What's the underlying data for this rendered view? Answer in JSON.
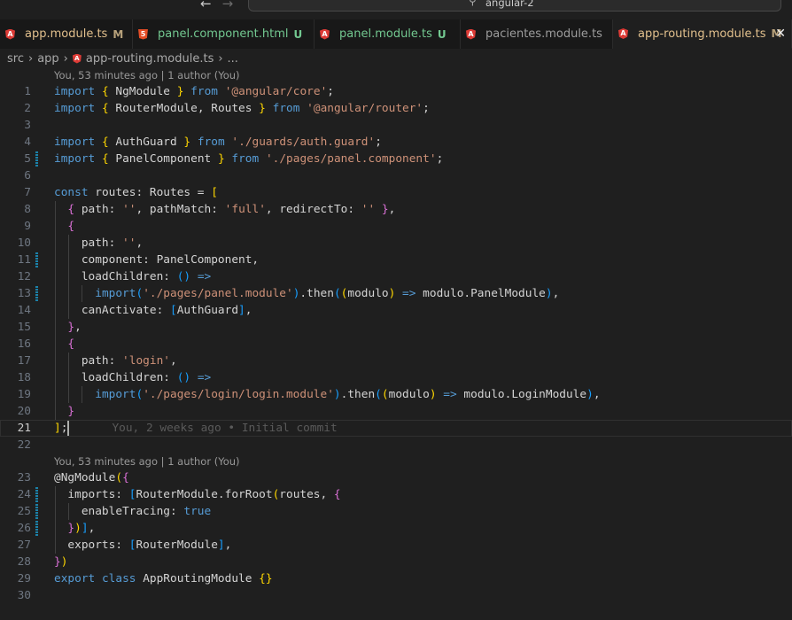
{
  "titlebar": {
    "search_text": "angular-2",
    "back": "←",
    "forward": "→"
  },
  "tabs": [
    {
      "label": "app.module.ts",
      "badge": "M",
      "icon": "angular-icon",
      "color": "#e2c08d",
      "badge_color": "#b8a27c"
    },
    {
      "label": "panel.component.html",
      "badge": "U",
      "icon": "html5-icon",
      "color": "#73c991",
      "badge_color": "#73c991"
    },
    {
      "label": "panel.module.ts",
      "badge": "U",
      "icon": "angular-icon",
      "color": "#73c991",
      "badge_color": "#73c991"
    },
    {
      "label": "pacientes.module.ts",
      "badge": "",
      "icon": "angular-icon",
      "color": "#9d9d9d",
      "badge_color": ""
    },
    {
      "label": "app-routing.module.ts",
      "badge": "M",
      "icon": "angular-icon",
      "color": "#e2c08d",
      "badge_color": "#b8a27c",
      "active": true
    }
  ],
  "breadcrumb": [
    "src",
    "app",
    "app-routing.module.ts",
    "..."
  ],
  "codelens": [
    "You, 53 minutes ago | 1 author (You)",
    "You, 53 minutes ago | 1 author (You)"
  ],
  "blame": "You, 2 weeks ago • Initial commit",
  "lines": [
    [
      [
        "import",
        "k"
      ],
      [
        " ",
        "p"
      ],
      [
        "{",
        "b1"
      ],
      [
        " NgModule ",
        "p"
      ],
      [
        "}",
        "b1"
      ],
      [
        " ",
        "p"
      ],
      [
        "from",
        "k"
      ],
      [
        " ",
        "p"
      ],
      [
        "'@angular/core'",
        "s"
      ],
      [
        ";",
        "p"
      ]
    ],
    [
      [
        "import",
        "k"
      ],
      [
        " ",
        "p"
      ],
      [
        "{",
        "b1"
      ],
      [
        " RouterModule, Routes ",
        "p"
      ],
      [
        "}",
        "b1"
      ],
      [
        " ",
        "p"
      ],
      [
        "from",
        "k"
      ],
      [
        " ",
        "p"
      ],
      [
        "'@angular/router'",
        "s"
      ],
      [
        ";",
        "p"
      ]
    ],
    [],
    [
      [
        "import",
        "k"
      ],
      [
        " ",
        "p"
      ],
      [
        "{",
        "b1"
      ],
      [
        " AuthGuard ",
        "p"
      ],
      [
        "}",
        "b1"
      ],
      [
        " ",
        "p"
      ],
      [
        "from",
        "k"
      ],
      [
        " ",
        "p"
      ],
      [
        "'./guards/auth.guard'",
        "s"
      ],
      [
        ";",
        "p"
      ]
    ],
    [
      [
        "import",
        "k"
      ],
      [
        " ",
        "p"
      ],
      [
        "{",
        "b1"
      ],
      [
        " PanelComponent ",
        "p"
      ],
      [
        "}",
        "b1"
      ],
      [
        " ",
        "p"
      ],
      [
        "from",
        "k"
      ],
      [
        " ",
        "p"
      ],
      [
        "'./pages/panel.component'",
        "s"
      ],
      [
        ";",
        "p"
      ]
    ],
    [],
    [
      [
        "const",
        "k"
      ],
      [
        " routes: Routes = ",
        "p"
      ],
      [
        "[",
        "b1"
      ]
    ],
    [
      [
        "  ",
        "p"
      ],
      [
        "{",
        "b2"
      ],
      [
        " path: ",
        "p"
      ],
      [
        "''",
        "s"
      ],
      [
        ", pathMatch: ",
        "p"
      ],
      [
        "'full'",
        "s"
      ],
      [
        ", redirectTo: ",
        "p"
      ],
      [
        "''",
        "s"
      ],
      [
        " ",
        "p"
      ],
      [
        "}",
        "b2"
      ],
      [
        ",",
        "p"
      ]
    ],
    [
      [
        "  ",
        "p"
      ],
      [
        "{",
        "b2"
      ]
    ],
    [
      [
        "    path: ",
        "p"
      ],
      [
        "''",
        "s"
      ],
      [
        ",",
        "p"
      ]
    ],
    [
      [
        "    component: PanelComponent,",
        "p"
      ]
    ],
    [
      [
        "    loadChildren: ",
        "p"
      ],
      [
        "()",
        "b3"
      ],
      [
        " ",
        "p"
      ],
      [
        "=>",
        "k"
      ]
    ],
    [
      [
        "      ",
        "p"
      ],
      [
        "import",
        "k"
      ],
      [
        "(",
        "b3"
      ],
      [
        "'./pages/panel.module'",
        "s"
      ],
      [
        ")",
        "b3"
      ],
      [
        ".then",
        "p"
      ],
      [
        "(",
        "b3"
      ],
      [
        "(",
        "b1"
      ],
      [
        "modulo",
        "p"
      ],
      [
        ")",
        "b1"
      ],
      [
        " ",
        "p"
      ],
      [
        "=>",
        "k"
      ],
      [
        " modulo.PanelModule",
        "p"
      ],
      [
        ")",
        "b3"
      ],
      [
        ",",
        "p"
      ]
    ],
    [
      [
        "    canActivate: ",
        "p"
      ],
      [
        "[",
        "b3"
      ],
      [
        "AuthGuard",
        "p"
      ],
      [
        "]",
        "b3"
      ],
      [
        ",",
        "p"
      ]
    ],
    [
      [
        "  ",
        "p"
      ],
      [
        "}",
        "b2"
      ],
      [
        ",",
        "p"
      ]
    ],
    [
      [
        "  ",
        "p"
      ],
      [
        "{",
        "b2"
      ]
    ],
    [
      [
        "    path: ",
        "p"
      ],
      [
        "'login'",
        "s"
      ],
      [
        ",",
        "p"
      ]
    ],
    [
      [
        "    loadChildren: ",
        "p"
      ],
      [
        "()",
        "b3"
      ],
      [
        " ",
        "p"
      ],
      [
        "=>",
        "k"
      ]
    ],
    [
      [
        "      ",
        "p"
      ],
      [
        "import",
        "k"
      ],
      [
        "(",
        "b3"
      ],
      [
        "'./pages/login/login.module'",
        "s"
      ],
      [
        ")",
        "b3"
      ],
      [
        ".then",
        "p"
      ],
      [
        "(",
        "b3"
      ],
      [
        "(",
        "b1"
      ],
      [
        "modulo",
        "p"
      ],
      [
        ")",
        "b1"
      ],
      [
        " ",
        "p"
      ],
      [
        "=>",
        "k"
      ],
      [
        " modulo.LoginModule",
        "p"
      ],
      [
        ")",
        "b3"
      ],
      [
        ",",
        "p"
      ]
    ],
    [
      [
        "  ",
        "p"
      ],
      [
        "}",
        "b2"
      ]
    ],
    [
      [
        "]",
        "b1"
      ],
      [
        ";",
        "p"
      ]
    ],
    [],
    [
      [
        "@NgModule",
        "p"
      ],
      [
        "(",
        "b1"
      ],
      [
        "{",
        "b2"
      ]
    ],
    [
      [
        "  imports: ",
        "p"
      ],
      [
        "[",
        "b3"
      ],
      [
        "RouterModule.forRoot",
        "p"
      ],
      [
        "(",
        "b1"
      ],
      [
        "routes, ",
        "p"
      ],
      [
        "{",
        "b2"
      ]
    ],
    [
      [
        "    enableTracing: ",
        "p"
      ],
      [
        "true",
        "k"
      ]
    ],
    [
      [
        "  ",
        "p"
      ],
      [
        "}",
        "b2"
      ],
      [
        ")",
        "b1"
      ],
      [
        "]",
        "b3"
      ],
      [
        ",",
        "p"
      ]
    ],
    [
      [
        "  exports: ",
        "p"
      ],
      [
        "[",
        "b3"
      ],
      [
        "RouterModule",
        "p"
      ],
      [
        "]",
        "b3"
      ],
      [
        ",",
        "p"
      ]
    ],
    [
      [
        "}",
        "b2"
      ],
      [
        ")",
        "b1"
      ]
    ],
    [
      [
        "export",
        "k"
      ],
      [
        " ",
        "p"
      ],
      [
        "class",
        "k"
      ],
      [
        " AppRoutingModule ",
        "p"
      ],
      [
        "{}",
        "b1"
      ]
    ],
    []
  ],
  "modified_lines": [
    5,
    11,
    13,
    24,
    25,
    26
  ],
  "current_line": 21
}
